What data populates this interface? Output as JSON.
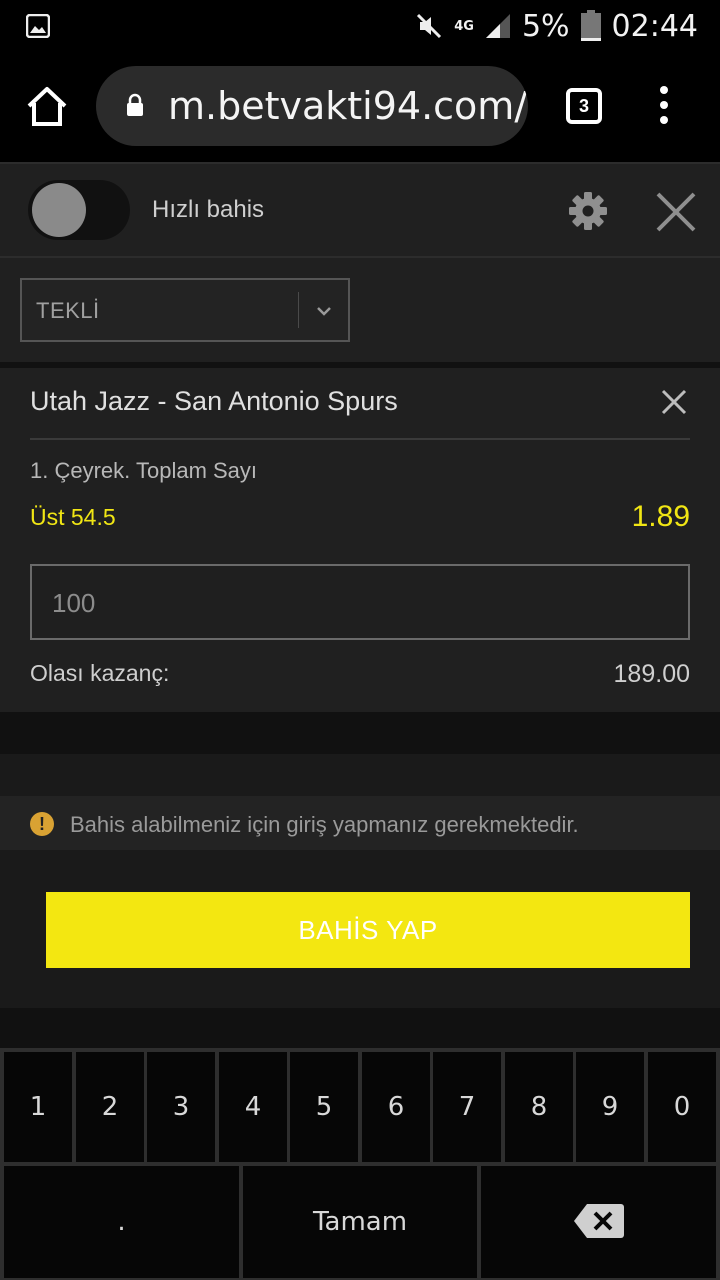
{
  "status_bar": {
    "network": "4G",
    "battery": "5%",
    "time": "02:44",
    "icons": [
      "gallery-icon",
      "mute-icon",
      "signal-icon",
      "battery-icon"
    ]
  },
  "browser": {
    "url": "m.betvakti94.com/",
    "tab_count": "3",
    "icons": [
      "home-icon",
      "lock-icon",
      "overflow-menu-icon"
    ]
  },
  "quick_bet": {
    "label": "Hızlı bahis",
    "enabled": false,
    "icons": [
      "gear-icon",
      "close-icon"
    ]
  },
  "bet_type": {
    "selected": "TEKLİ"
  },
  "slip": {
    "match": "Utah Jazz - San Antonio Spurs",
    "market": "1. Çeyrek. Toplam Sayı",
    "selection": "Üst 54.5",
    "odds": "1.89",
    "stake_placeholder": "100",
    "potential_label": "Olası kazanç:",
    "potential_value": "189.00"
  },
  "notice": {
    "text": "Bahis alabilmeniz için giriş yapmanız gerekmektedir."
  },
  "place_bet": {
    "label": "BAHİS YAP"
  },
  "keyboard": {
    "digits": [
      "1",
      "2",
      "3",
      "4",
      "5",
      "6",
      "7",
      "8",
      "9",
      "0"
    ],
    "dot": ".",
    "done": "Tamam",
    "backspace_icon": "backspace-icon"
  },
  "colors": {
    "accent_yellow": "#f3e711",
    "panel": "#202020",
    "background": "#111111",
    "warning": "#d9a233"
  }
}
